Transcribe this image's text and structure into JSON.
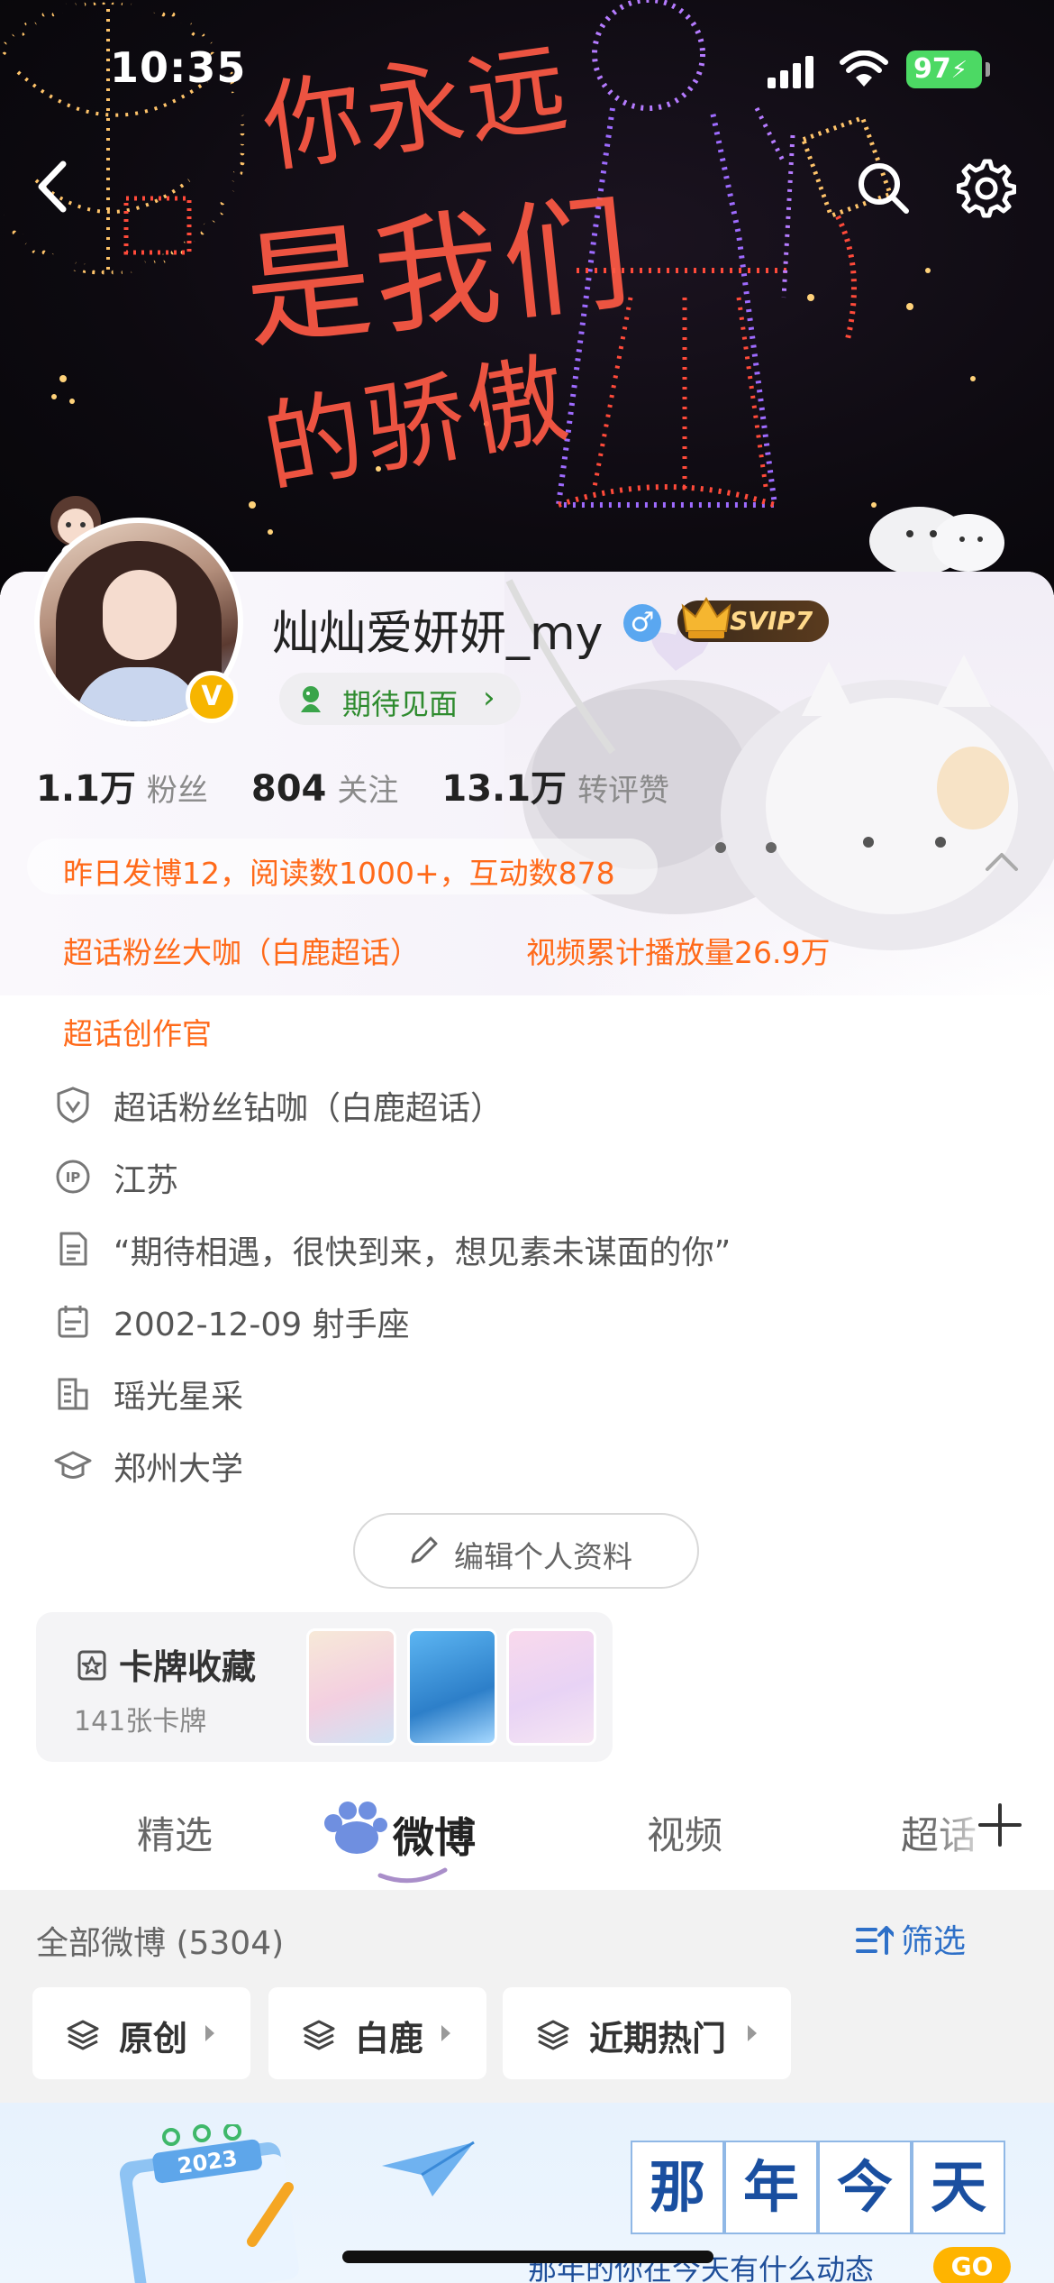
{
  "status_bar": {
    "time": "10:35",
    "battery": "97"
  },
  "banner": {
    "text_line1": "你永远",
    "text_line2": "是我们",
    "text_line3": "的骄傲"
  },
  "profile": {
    "username": "灿灿爱妍妍_my",
    "gender_symbol": "♂",
    "vip_badge": "SVIP7",
    "verified_symbol": "V",
    "status_pill": "期待见面",
    "status_chevron": "›",
    "stats": [
      {
        "value": "1.1万",
        "label": "粉丝"
      },
      {
        "value": "804",
        "label": "关注"
      },
      {
        "value": "13.1万",
        "label": "转评赞"
      }
    ],
    "highlights": {
      "yesterday": "昨日发博12，阅读数1000+，互动数878",
      "fan_title": "超话粉丝大咖（白鹿超话）",
      "video_plays": "视频累计播放量26.9万",
      "creator": "超话创作官"
    },
    "info": {
      "badge": "超话粉丝钻咖（白鹿超话）",
      "ip": "江苏",
      "bio": "“期待相遇，很快到来，想见素未谋面的你”",
      "birthday": "2002-12-09 射手座",
      "company": "瑶光星采",
      "school": "郑州大学"
    },
    "edit_button": "编辑个人资料"
  },
  "card_collection": {
    "title": "卡牌收藏",
    "count": "141张卡牌"
  },
  "tabs": [
    "精选",
    "微博",
    "视频",
    "超话"
  ],
  "active_tab": "微博",
  "feed": {
    "count_label": "全部微博 (5304)",
    "filter_label": "筛选",
    "chips": [
      "原创",
      "白鹿",
      "近期热门"
    ]
  },
  "memories": {
    "words": [
      "那",
      "年",
      "今",
      "天"
    ],
    "calendar_year": "2023",
    "subtitle": "那年的你在今天有什么动态",
    "go": "GO"
  },
  "colors": {
    "accent_orange": "#ff6a1a",
    "link_blue": "#2e70c8",
    "pill_green": "#2e8b2e",
    "verified_gold": "#f7b500"
  }
}
